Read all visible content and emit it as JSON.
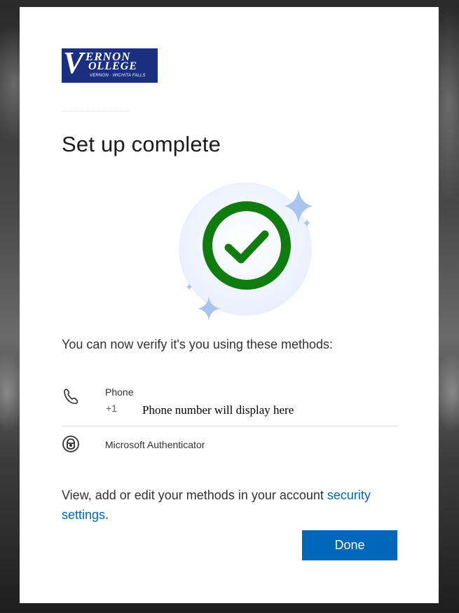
{
  "logo": {
    "mark": "V",
    "line1": "ERNON",
    "line2": "OLLEGE",
    "subtitle": "VERNON · WICHITA FALLS"
  },
  "title": "Set up complete",
  "lead_text": "You can now verify it's you using these methods:",
  "methods": [
    {
      "name": "Phone",
      "country_code": "+1",
      "detail": "Phone number will display here",
      "icon": "phone-icon"
    },
    {
      "name": "Microsoft Authenticator",
      "icon": "authenticator-lock-icon"
    }
  ],
  "footer": {
    "text": "View, add or edit your methods in your account ",
    "link_label": "security settings",
    "suffix": "."
  },
  "done_label": "Done",
  "colors": {
    "accent": "#0067b8",
    "success": "#107c10",
    "logo_bg": "#1b2f80"
  }
}
